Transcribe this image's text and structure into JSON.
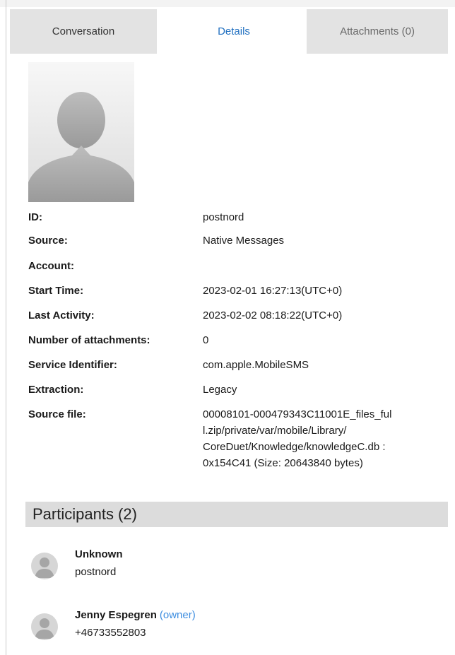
{
  "tabs": [
    {
      "label": "Conversation"
    },
    {
      "label": "Details"
    },
    {
      "label": "Attachments (0)"
    }
  ],
  "details": [
    {
      "label": "ID:",
      "value": "postnord"
    },
    {
      "label": "Source:",
      "value": "Native Messages"
    },
    {
      "label": "Account:",
      "value": ""
    },
    {
      "label": "Start Time:",
      "value": "2023-02-01 16:27:13(UTC+0)"
    },
    {
      "label": "Last Activity:",
      "value": "2023-02-02 08:18:22(UTC+0)"
    },
    {
      "label": "Number of attachments:",
      "value": "0"
    },
    {
      "label": "Service Identifier:",
      "value": "com.apple.MobileSMS"
    },
    {
      "label": "Extraction:",
      "value": "Legacy"
    },
    {
      "label": "Source file:",
      "value_lines": [
        "00008101-000479343C11001E_files_ful",
        "l.zip/private/var/mobile/Library/",
        "CoreDuet/Knowledge/knowledgeC.db :",
        "0x154C41 (Size: 20643840 bytes)"
      ]
    }
  ],
  "participants_header": "Participants (2)",
  "participants": [
    {
      "name": "Unknown",
      "owner_tag": "",
      "sub": "postnord"
    },
    {
      "name": "Jenny Espegren",
      "owner_tag": "(owner)",
      "sub": "+46733552803"
    }
  ],
  "icons": [
    "default-avatar-icon"
  ]
}
